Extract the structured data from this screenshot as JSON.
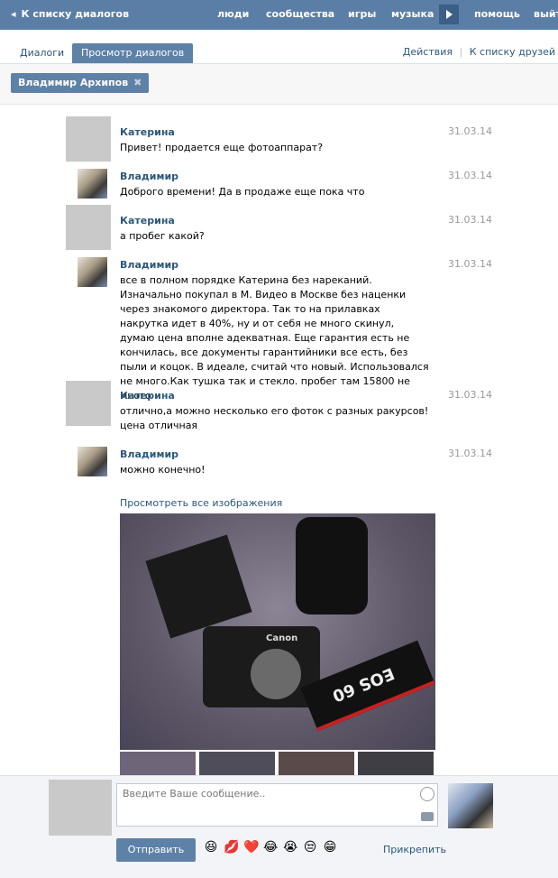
{
  "topbar": {
    "back_label": "К списку диалогов",
    "nav": [
      "люди",
      "сообщества",
      "игры",
      "музыка",
      "помощь",
      "выйти"
    ]
  },
  "tabs": [
    "Диалоги",
    "Просмотр диалогов"
  ],
  "right_links": {
    "actions": "Действия",
    "sep": "|",
    "friends": "К списку друзей"
  },
  "filter_chip": "Владимир Архипов",
  "messages": [
    {
      "author": "Катерина",
      "date": "31.03.14",
      "text": "Привет! продается еще фотоаппарат?"
    },
    {
      "author": "Владимир",
      "date": "31.03.14",
      "text": "Доброго времени! Да в продаже еще пока что"
    },
    {
      "author": "Катерина",
      "date": "31.03.14",
      "text": "а пробег какой?"
    },
    {
      "author": "Владимир",
      "date": "31.03.14",
      "text": "все в полном порядке Катерина без нареканий. Изначально покупал в М. Видео в Москве без наценки через знакомого директора. Так то на прилавках накрутка идет в 40%, ну и от себя не много скинул, думаю цена вполне адекватная. Еще гарантия есть не кончилась, все документы гарантийники все есть, без пыли и коцок. В идеале, считай что новый. Использовался не много.Как тушка так и стекло. пробег там 15800 не много"
    },
    {
      "author": "Катерина",
      "date": "31.03.14",
      "text": "отлично,а можно несколько его фоток с разных ракурсов! цена отличная"
    },
    {
      "author": "Владимир",
      "date": "31.03.14",
      "text": "можно конечно!"
    }
  ],
  "view_all_images": "Просмотреть все изображения",
  "photo_brand": "Canon",
  "strap_text": "EOS 60",
  "composer": {
    "placeholder": "Введите Ваше сообщение..",
    "send_label": "Отправить",
    "attach_label": "Прикрепить",
    "emojis": [
      "😆",
      "💋",
      "❤️",
      "😂",
      "😭",
      "😒",
      "😁"
    ]
  }
}
